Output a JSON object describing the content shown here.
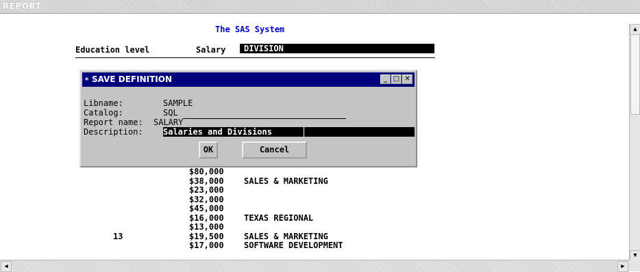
{
  "window": {
    "title": "REPORT"
  },
  "report": {
    "system_title": "The SAS System",
    "columns": {
      "education": "Education level",
      "salary": "Salary",
      "division": "DIVISION"
    },
    "rows": [
      {
        "edu": "",
        "salary": "$80,000",
        "division": ""
      },
      {
        "edu": "",
        "salary": "$38,000",
        "division": "SALES & MARKETING"
      },
      {
        "edu": "",
        "salary": "$23,000",
        "division": ""
      },
      {
        "edu": "",
        "salary": "$32,000",
        "division": ""
      },
      {
        "edu": "",
        "salary": "$45,000",
        "division": ""
      },
      {
        "edu": "",
        "salary": "$16,000",
        "division": "TEXAS REGIONAL"
      },
      {
        "edu": "",
        "salary": "$13,000",
        "division": ""
      },
      {
        "edu": "13",
        "salary": "$19,500",
        "division": "SALES & MARKETING"
      },
      {
        "edu": "",
        "salary": "$17,000",
        "division": "SOFTWARE DEVELOPMENT"
      }
    ]
  },
  "dialog": {
    "title": "SAVE DEFINITION",
    "libname_label": "Libname:",
    "libname_value": "SAMPLE",
    "catalog_label": "Catalog:",
    "catalog_value": "SQL",
    "report_name_label": "Report name:",
    "report_name_value": "SALARY",
    "description_label": "Description:",
    "description_value": "Salaries and Divisions",
    "ok_label": "OK",
    "cancel_label": "Cancel"
  }
}
